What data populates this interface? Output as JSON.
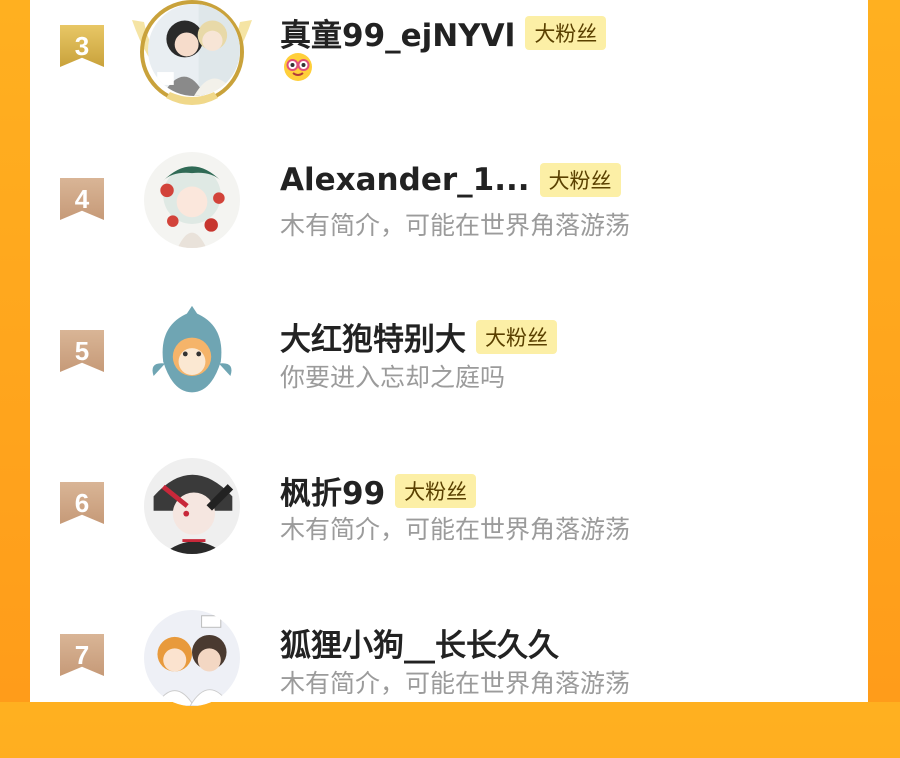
{
  "colors": {
    "frame": "#ffa81f",
    "badge_bg": "#fcefa6",
    "rank_gold": "#d4af4a",
    "rank_brown": "#cfa584"
  },
  "rows": [
    {
      "rank": "3",
      "name": "真童99_ejNYVl",
      "badge": "大粉丝",
      "bio": "",
      "status_icon": "nerd-face-emoji-icon"
    },
    {
      "rank": "4",
      "name": "Alexander_1...",
      "badge": "大粉丝",
      "bio": "木有简介，可能在世界角落游荡"
    },
    {
      "rank": "5",
      "name": "大红狍特别大",
      "badge": "大粉丝",
      "bio": "你要进入忘却之庭吗"
    },
    {
      "rank": "6",
      "name": "枫折99",
      "badge": "大粉丝",
      "bio": "木有简介，可能在世界角落游荡"
    },
    {
      "rank": "7",
      "name": "狐狸小狗__长长久久",
      "badge": "",
      "bio": "木有简介，可能在世界角落游荡"
    }
  ]
}
